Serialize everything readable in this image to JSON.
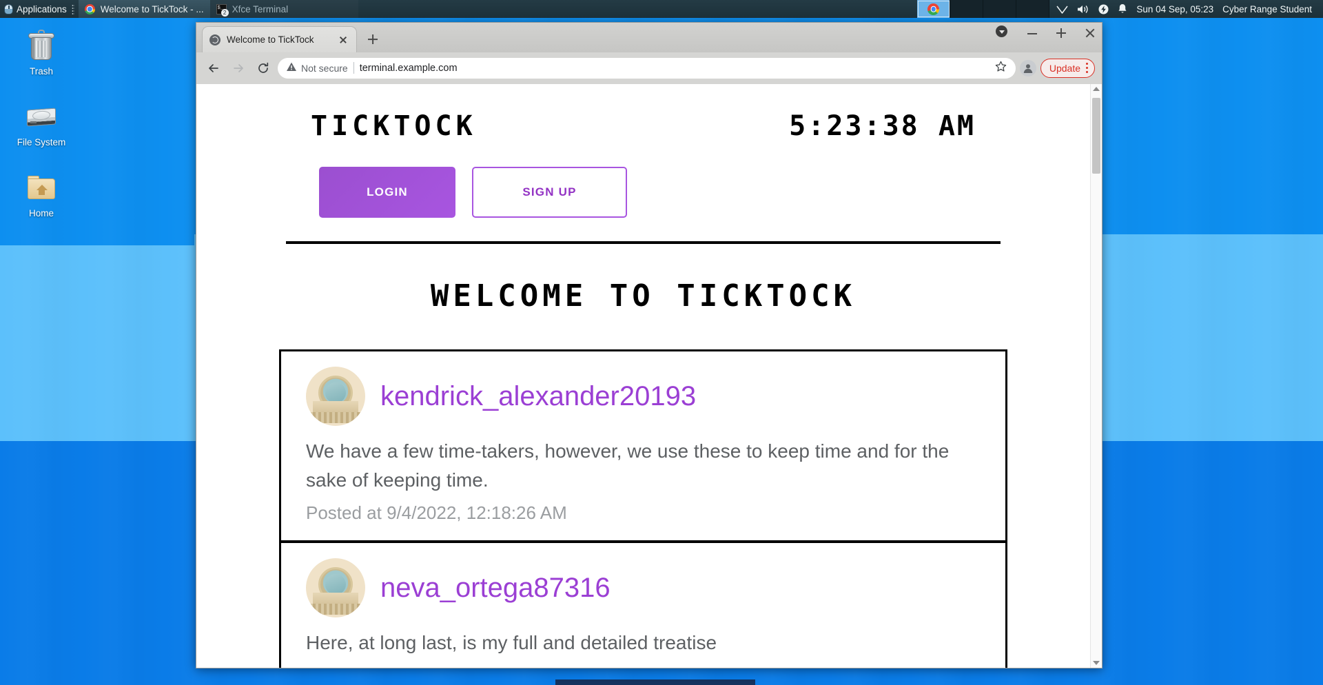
{
  "panel": {
    "applications_label": "Applications",
    "tasks": [
      {
        "label": "Welcome to TickTock - ...",
        "icon": "chrome-icon",
        "active": true
      },
      {
        "label": "Xfce Terminal",
        "icon": "terminal-icon",
        "badge": "2",
        "active": false
      }
    ],
    "tray": {
      "network_icon": "wifi-icon",
      "volume_icon": "speaker-icon",
      "power_icon": "power-icon",
      "notification_icon": "bell-icon"
    },
    "clock": "Sun 04 Sep, 05:23",
    "user": "Cyber Range Student"
  },
  "desktop": {
    "icons": [
      {
        "label": "Trash",
        "icon": "trash-icon"
      },
      {
        "label": "File System",
        "icon": "harddrive-icon"
      },
      {
        "label": "Home",
        "icon": "home-folder-icon"
      }
    ]
  },
  "browser": {
    "tab": {
      "title": "Welcome to TickTock",
      "favicon": "globe-icon"
    },
    "newtab_tooltip": "New Tab",
    "nav": {
      "back": "back-arrow-icon",
      "forward": "forward-arrow-icon",
      "reload": "reload-icon"
    },
    "omnibox": {
      "security_label": "Not secure",
      "security_icon": "warning-triangle-icon",
      "url": "terminal.example.com",
      "bookmark_icon": "star-icon"
    },
    "profile_icon": "profile-avatar-icon",
    "update_label": "Update",
    "menu_icon": "kebab-menu-icon",
    "window_controls": {
      "dropdown": "window-menu-icon",
      "minimize": "minimize-icon",
      "maximize": "maximize-icon",
      "close": "close-icon"
    }
  },
  "page": {
    "brand": "TICKTOCK",
    "clock": "5:23:38 AM",
    "login_label": "LOGIN",
    "signup_label": "SIGN UP",
    "heading": "WELCOME TO TICKTOCK",
    "accent_color": "#a855e0",
    "link_color": "#9b3fd4",
    "posts": [
      {
        "username": "kendrick_alexander20193",
        "body": "We have a few time-takers, however, we use these to keep time and for the sake of keeping time.",
        "meta": "Posted at 9/4/2022, 12:18:26 AM",
        "avatar_icon": "clock-medallion-avatar"
      },
      {
        "username": "neva_ortega87316",
        "body": "Here, at long last, is my full and detailed treatise",
        "meta": "",
        "avatar_icon": "clock-medallion-avatar"
      }
    ]
  }
}
